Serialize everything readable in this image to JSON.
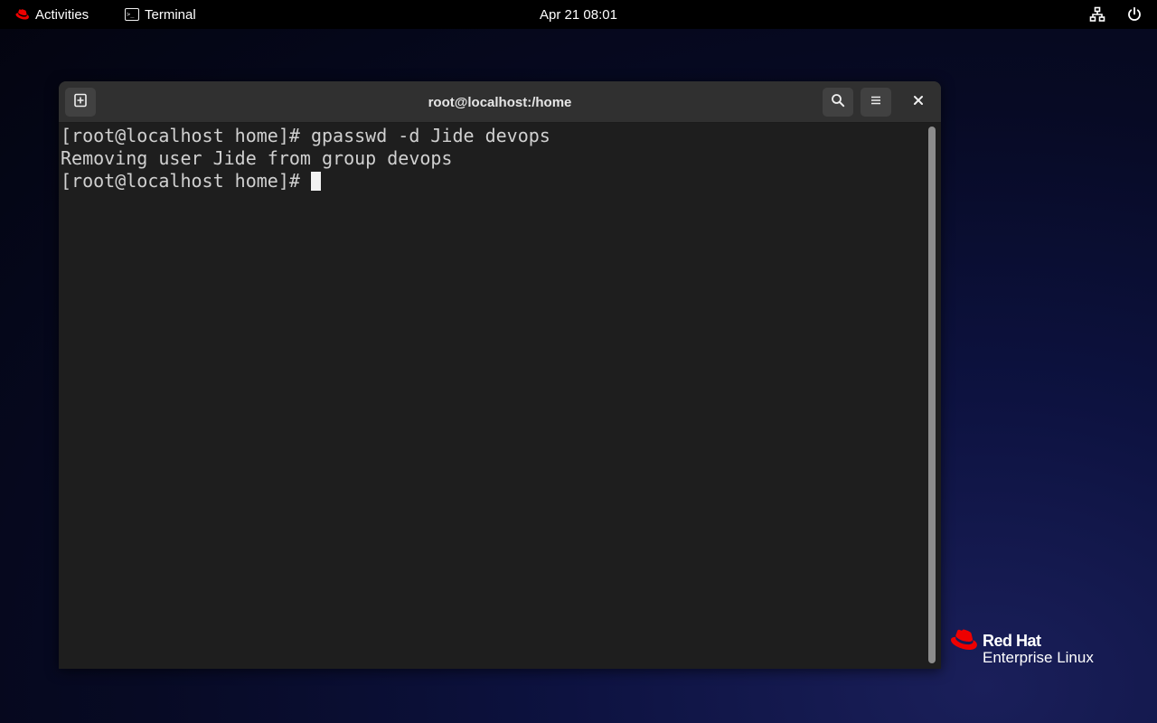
{
  "topbar": {
    "activities_label": "Activities",
    "app_label": "Terminal",
    "clock": "Apr 21  08:01"
  },
  "window": {
    "title": "root@localhost:/home"
  },
  "terminal": {
    "lines": [
      "[root@localhost home]# gpasswd -d Jide devops",
      "Removing user Jide from group devops",
      "[root@localhost home]# "
    ]
  },
  "desktop_logo": {
    "line1": "Red Hat",
    "line2": "Enterprise Linux"
  },
  "icons": {
    "activities": "redhat-icon",
    "app": "terminal-icon",
    "network": "network-icon",
    "power": "power-icon",
    "new_tab": "new-tab-icon",
    "search": "search-icon",
    "menu": "hamburger-menu-icon",
    "close": "close-icon"
  },
  "colors": {
    "brand_red": "#ee0000",
    "topbar": "#000000",
    "terminal_bg": "#1e1e1e",
    "headerbar": "#303030"
  }
}
